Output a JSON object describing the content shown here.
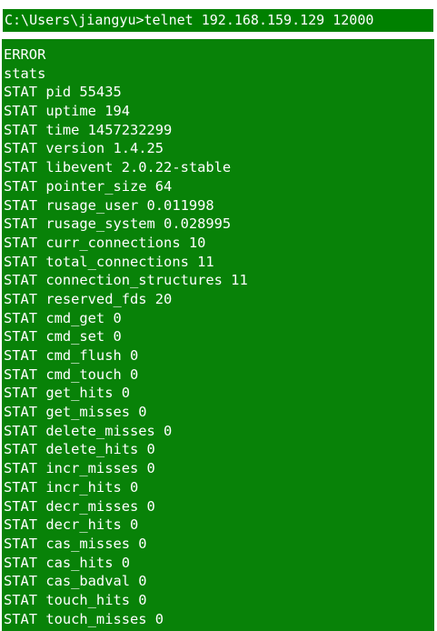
{
  "command_prompt": "C:\\Users\\jiangyu>telnet 192.168.159.129 12000",
  "lines": [
    "ERROR",
    "stats",
    "STAT pid 55435",
    "STAT uptime 194",
    "STAT time 1457232299",
    "STAT version 1.4.25",
    "STAT libevent 2.0.22-stable",
    "STAT pointer_size 64",
    "STAT rusage_user 0.011998",
    "STAT rusage_system 0.028995",
    "STAT curr_connections 10",
    "STAT total_connections 11",
    "STAT connection_structures 11",
    "STAT reserved_fds 20",
    "STAT cmd_get 0",
    "STAT cmd_set 0",
    "STAT cmd_flush 0",
    "STAT cmd_touch 0",
    "STAT get_hits 0",
    "STAT get_misses 0",
    "STAT delete_misses 0",
    "STAT delete_hits 0",
    "STAT incr_misses 0",
    "STAT incr_hits 0",
    "STAT decr_misses 0",
    "STAT decr_hits 0",
    "STAT cas_misses 0",
    "STAT cas_hits 0",
    "STAT cas_badval 0",
    "STAT touch_hits 0",
    "STAT touch_misses 0"
  ],
  "colors": {
    "terminal_background": "#088208",
    "command_highlight": "#008000",
    "text": "#ffffff"
  }
}
